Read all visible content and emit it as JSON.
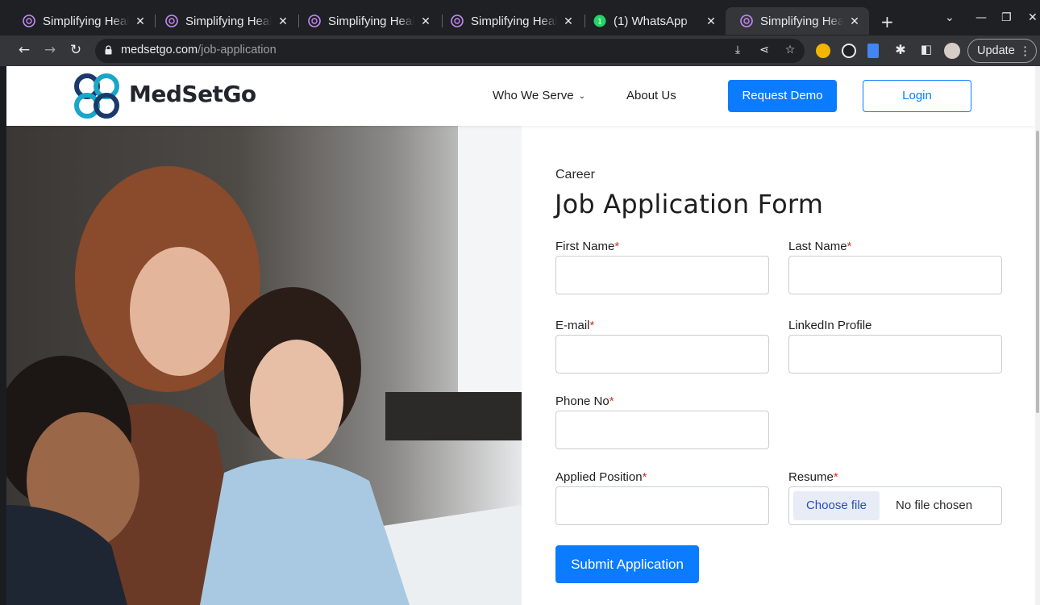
{
  "browser": {
    "tabs": [
      {
        "title": "Simplifying Heal",
        "active": false
      },
      {
        "title": "Simplifying Heal",
        "active": false
      },
      {
        "title": "Simplifying Heal",
        "active": false
      },
      {
        "title": "Simplifying Heal",
        "active": false
      },
      {
        "title": "(1) WhatsApp",
        "active": false
      },
      {
        "title": "Simplifying Heal",
        "active": true
      }
    ],
    "url_domain": "medsetgo.com",
    "url_path": "/job-application",
    "update_label": "Update"
  },
  "site": {
    "logo_text": "MedSetGo",
    "nav": {
      "who_we_serve": "Who We Serve",
      "about_us": "About Us",
      "request_demo": "Request Demo",
      "login": "Login"
    }
  },
  "form": {
    "eyebrow": "Career",
    "title": "Job Application Form",
    "required_mark": "*",
    "fields": {
      "first_name": {
        "label": "First Name",
        "value": ""
      },
      "last_name": {
        "label": "Last Name",
        "value": ""
      },
      "email": {
        "label": "E-mail",
        "value": ""
      },
      "linkedin": {
        "label": "LinkedIn Profile",
        "value": ""
      },
      "phone": {
        "label": "Phone No",
        "value": ""
      },
      "applied_position": {
        "label": "Applied Position",
        "value": ""
      },
      "resume": {
        "label": "Resume",
        "button": "Choose file",
        "status": "No file chosen"
      }
    },
    "submit_label": "Submit Application"
  },
  "colors": {
    "primary": "#0b7bff",
    "required": "#d93025",
    "logo_teal": "#1aa6c8",
    "logo_navy": "#1b3a6b"
  }
}
